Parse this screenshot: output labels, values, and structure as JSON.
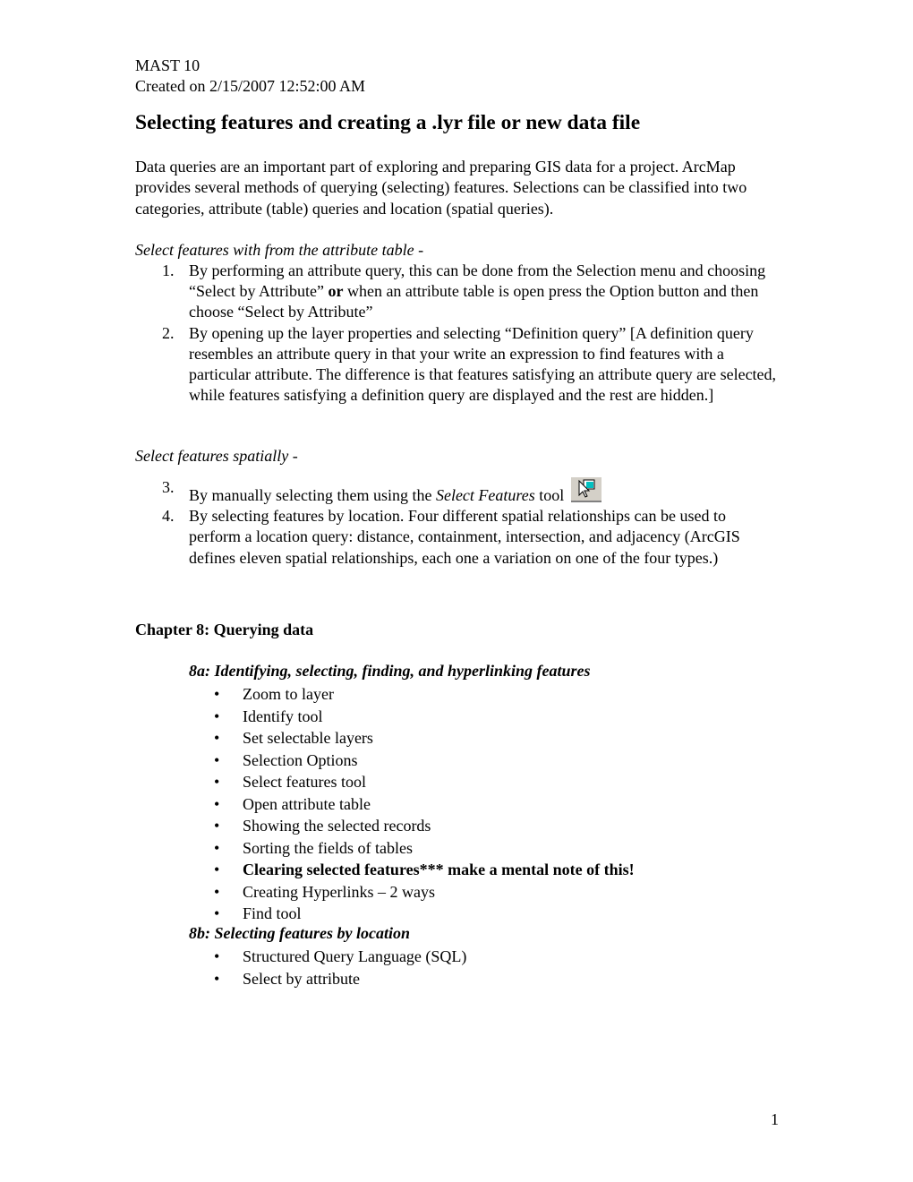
{
  "header": {
    "course": "MAST 10",
    "created": " Created on 2/15/2007 12:52:00 AM"
  },
  "title": "Selecting features and creating a .lyr file or new data file",
  "intro": "Data queries are an important part of exploring and preparing GIS data for a project. ArcMap provides several methods of querying (selecting) features. Selections can be classified into two categories, attribute (table) queries and location (spatial queries).",
  "section1": {
    "heading": "Select features with from the attribute table",
    "heading_suffix": " -",
    "items": [
      {
        "num": "1.",
        "text_a": "By performing an attribute query, this can be done from the Selection menu and choosing “Select by Attribute” ",
        "bold": "or",
        "text_b": " when an attribute table is open press the Option button and then choose “Select by Attribute”"
      },
      {
        "num": "2.",
        "text": "By opening up the layer properties and selecting “Definition query” [A definition query resembles an attribute query in that your write an expression to find features with a particular attribute.  The difference is that features satisfying an attribute query are selected, while features satisfying a definition query are displayed and the rest are hidden.]"
      }
    ]
  },
  "section2": {
    "heading": "Select features spatially",
    "heading_suffix": " -",
    "items": [
      {
        "num": "3.",
        "text_a": "By manually selecting them using the ",
        "italic": "Select Features",
        "text_b": " tool",
        "icon": "select-features-tool-icon"
      },
      {
        "num": "4.",
        "text": "By selecting features by location.  Four different spatial relationships can be used to perform a location query: distance, containment, intersection, and adjacency (ArcGIS defines eleven spatial relationships, each one a variation on one of the four types.)"
      }
    ]
  },
  "chapter": {
    "title": "Chapter 8: Querying data",
    "sub_a": {
      "heading": "8a: Identifying, selecting, finding, and hyperlinking features",
      "items": [
        "Zoom to layer",
        "Identify tool",
        "Set selectable layers",
        "Selection Options",
        "Select features tool",
        "Open attribute table",
        "Showing the selected records",
        "Sorting the fields of tables",
        "Clearing selected features*** make a mental note of this!",
        "Creating Hyperlinks – 2 ways",
        "Find tool"
      ]
    },
    "sub_b": {
      "heading": "8b: Selecting features by location",
      "items": [
        "Structured Query Language (SQL)",
        "Select by attribute"
      ]
    }
  },
  "footer": {
    "page_number": "1"
  },
  "bullet_glyph": "•"
}
